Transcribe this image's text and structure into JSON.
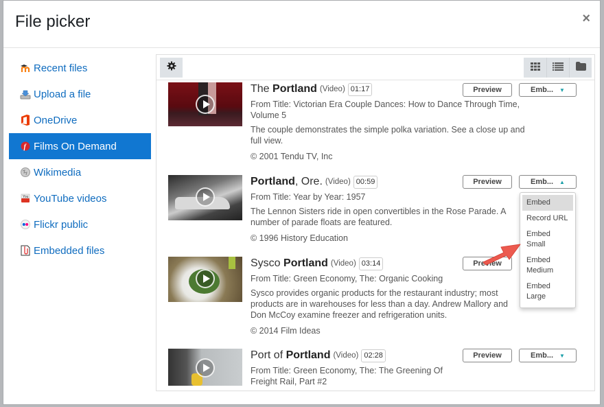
{
  "modal": {
    "title": "File picker",
    "close_label": "×"
  },
  "sidebar": {
    "items": [
      {
        "label": "Recent files",
        "icon": "moodle-icon"
      },
      {
        "label": "Upload a file",
        "icon": "upload-icon"
      },
      {
        "label": "OneDrive",
        "icon": "onedrive-icon"
      },
      {
        "label": "Films On Demand",
        "icon": "films-on-demand-icon",
        "active": true
      },
      {
        "label": "Wikimedia",
        "icon": "wikimedia-icon"
      },
      {
        "label": "YouTube videos",
        "icon": "youtube-icon"
      },
      {
        "label": "Flickr public",
        "icon": "flickr-icon"
      },
      {
        "label": "Embedded files",
        "icon": "embedded-files-icon"
      }
    ]
  },
  "toolbar": {
    "settings_icon": "gear-icon",
    "views": [
      "grid-view-icon",
      "list-view-icon",
      "folder-view-icon"
    ]
  },
  "results": [
    {
      "title_pre": "The ",
      "title_bold": "Portland",
      "title_post": "",
      "kind": "(Video)",
      "duration": "01:17",
      "from": "From Title: Victorian Era Couple Dances: How to Dance Through Time, Volume 5",
      "description": "The couple demonstrates the simple polka variation. See a close up and full view.",
      "copyright": "© 2001  Tendu TV, Inc",
      "preview_label": "Preview",
      "embed_label": "Emb...",
      "thumb_color": "#6b0f14"
    },
    {
      "title_pre": "",
      "title_bold": "Portland",
      "title_post": ", Ore.",
      "kind": "(Video)",
      "duration": "00:59",
      "from": "From Title: Year by Year: 1957",
      "description": "The Lennon Sisters ride in open convertibles in the Rose Parade. A number of parade floats are featured.",
      "copyright": "© 1996  History Education",
      "preview_label": "Preview",
      "embed_label": "Emb...",
      "thumb_color": "#555555"
    },
    {
      "title_pre": "Sysco ",
      "title_bold": "Portland",
      "title_post": "",
      "kind": "(Video)",
      "duration": "03:14",
      "from": "From Title: Green Economy, The: Organic Cooking",
      "description": "Sysco provides organic products for the restaurant industry; most products are in warehouses for less than a day. Andrew Mallory and Don McCoy examine freezer and refrigeration units.",
      "copyright": "© 2014  Film Ideas",
      "preview_label": "Preview",
      "embed_label": "Emb...",
      "thumb_color": "#4f6b3a"
    },
    {
      "title_pre": "Port of ",
      "title_bold": "Portland",
      "title_post": "",
      "kind": "(Video)",
      "duration": "02:28",
      "from": "From Title: Green Economy, The: The Greening Of Freight Rail, Part #2",
      "description": "",
      "copyright": "",
      "preview_label": "Preview",
      "embed_label": "Emb...",
      "thumb_color": "#7d8487"
    }
  ],
  "embed_menu": {
    "options": [
      "Embed",
      "Record URL",
      "Embed Small",
      "Embed Medium",
      "Embed Large"
    ],
    "highlighted": "Embed"
  },
  "colors": {
    "accent": "#1177d1",
    "link": "#0f6cbf",
    "caret": "#1a9fa8",
    "annotation_arrow": "#ec5a4f"
  }
}
